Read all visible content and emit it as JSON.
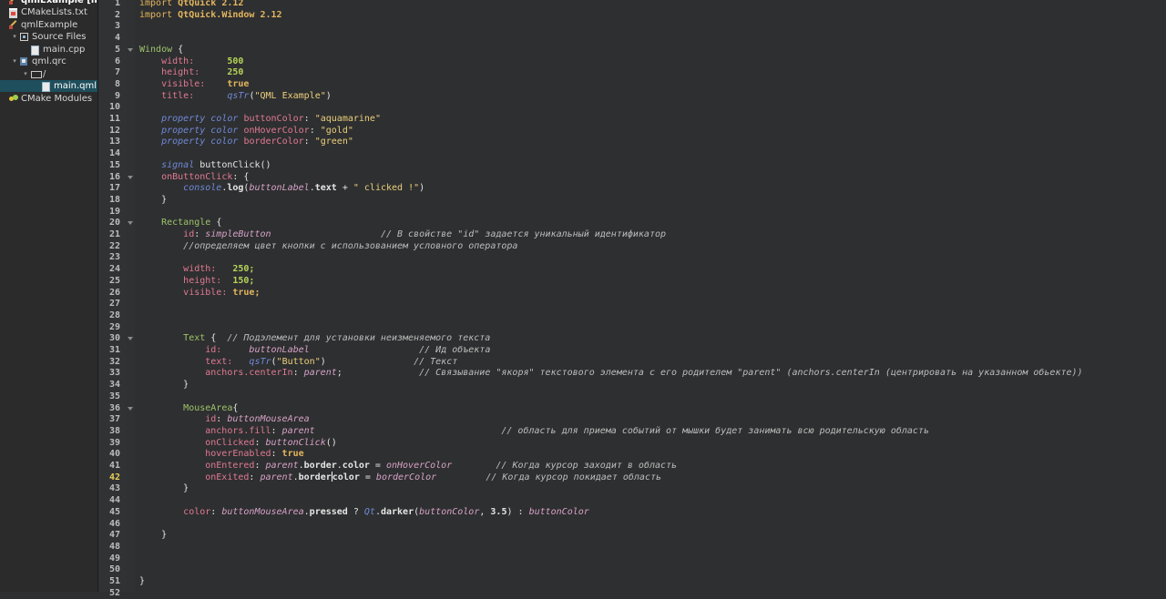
{
  "tree": [
    {
      "label": "qmlExample [mast",
      "icon": "project-icon",
      "indent": 0,
      "arrow": "",
      "title": true
    },
    {
      "label": "CMakeLists.txt",
      "icon": "cmake-icon",
      "indent": 0,
      "arrow": ""
    },
    {
      "label": "qmlExample",
      "icon": "project-icon",
      "indent": 0,
      "arrow": ""
    },
    {
      "label": "Source Files",
      "icon": "source-files-icon",
      "indent": 1,
      "arrow": "▾"
    },
    {
      "label": "main.cpp",
      "icon": "cpp-file-icon",
      "indent": 2,
      "arrow": ""
    },
    {
      "label": "qml.qrc",
      "icon": "qrc-icon",
      "indent": 1,
      "arrow": "▾"
    },
    {
      "label": "/",
      "icon": "folder-icon",
      "indent": 2,
      "arrow": "▾"
    },
    {
      "label": "main.qml",
      "icon": "qml-file-icon",
      "indent": 3,
      "arrow": "",
      "selected": true
    },
    {
      "label": "CMake Modules",
      "icon": "cmake-modules-icon",
      "indent": 0,
      "arrow": ""
    }
  ],
  "editor": {
    "current_line": 42,
    "fold_lines": [
      5,
      16,
      20,
      30,
      36
    ],
    "lines": [
      {
        "n": 1,
        "t": [
          [
            "kw",
            "import "
          ],
          [
            "mod",
            "QtQuick 2.12"
          ]
        ]
      },
      {
        "n": 2,
        "t": [
          [
            "kw",
            "import "
          ],
          [
            "mod",
            "QtQuick.Window 2.12"
          ]
        ]
      },
      {
        "n": 3,
        "t": []
      },
      {
        "n": 4,
        "t": []
      },
      {
        "n": 5,
        "t": [
          [
            "type",
            "Window "
          ],
          [
            "pl",
            "{"
          ]
        ]
      },
      {
        "n": 6,
        "t": [
          [
            "pl",
            "    "
          ],
          [
            "prop",
            "width:"
          ],
          [
            "pl",
            "      "
          ],
          [
            "num",
            "500"
          ]
        ]
      },
      {
        "n": 7,
        "t": [
          [
            "pl",
            "    "
          ],
          [
            "prop",
            "height:"
          ],
          [
            "pl",
            "     "
          ],
          [
            "num",
            "250"
          ]
        ]
      },
      {
        "n": 8,
        "t": [
          [
            "pl",
            "    "
          ],
          [
            "prop",
            "visible:"
          ],
          [
            "pl",
            "    "
          ],
          [
            "kwb",
            "true"
          ]
        ]
      },
      {
        "n": 9,
        "t": [
          [
            "pl",
            "    "
          ],
          [
            "prop",
            "title:"
          ],
          [
            "pl",
            "      "
          ],
          [
            "fn",
            "qsTr"
          ],
          [
            "pl",
            "("
          ],
          [
            "str",
            "\"QML Example\""
          ],
          [
            "pl",
            ")"
          ]
        ]
      },
      {
        "n": 10,
        "t": []
      },
      {
        "n": 11,
        "t": [
          [
            "pl",
            "    "
          ],
          [
            "fn",
            "property"
          ],
          [
            "pl",
            " "
          ],
          [
            "fn",
            "color"
          ],
          [
            "pl",
            " "
          ],
          [
            "prop",
            "buttonColor"
          ],
          [
            "pl",
            ": "
          ],
          [
            "str",
            "\"aquamarine\""
          ]
        ]
      },
      {
        "n": 12,
        "t": [
          [
            "pl",
            "    "
          ],
          [
            "fn",
            "property"
          ],
          [
            "pl",
            " "
          ],
          [
            "fn",
            "color"
          ],
          [
            "pl",
            " "
          ],
          [
            "prop",
            "onHoverColor"
          ],
          [
            "pl",
            ": "
          ],
          [
            "str",
            "\"gold\""
          ]
        ]
      },
      {
        "n": 13,
        "t": [
          [
            "pl",
            "    "
          ],
          [
            "fn",
            "property"
          ],
          [
            "pl",
            " "
          ],
          [
            "fn",
            "color"
          ],
          [
            "pl",
            " "
          ],
          [
            "prop",
            "borderColor"
          ],
          [
            "pl",
            ": "
          ],
          [
            "str",
            "\"green\""
          ]
        ]
      },
      {
        "n": 14,
        "t": []
      },
      {
        "n": 15,
        "t": [
          [
            "pl",
            "    "
          ],
          [
            "fn",
            "signal"
          ],
          [
            "pl",
            " buttonClick()"
          ]
        ]
      },
      {
        "n": 16,
        "t": [
          [
            "pl",
            "    "
          ],
          [
            "prop",
            "onButtonClick"
          ],
          [
            "pl",
            ": {"
          ]
        ]
      },
      {
        "n": 17,
        "t": [
          [
            "pl",
            "        "
          ],
          [
            "fn",
            "console"
          ],
          [
            "pl",
            "."
          ],
          [
            "bold",
            "log"
          ],
          [
            "pl",
            "("
          ],
          [
            "it",
            "buttonLabel"
          ],
          [
            "pl",
            "."
          ],
          [
            "bold",
            "text"
          ],
          [
            "pl",
            " + "
          ],
          [
            "str",
            "\" clicked !\""
          ],
          [
            "pl",
            ")"
          ]
        ]
      },
      {
        "n": 18,
        "t": [
          [
            "pl",
            "    }"
          ]
        ]
      },
      {
        "n": 19,
        "t": []
      },
      {
        "n": 20,
        "t": [
          [
            "pl",
            "    "
          ],
          [
            "type",
            "Rectangle "
          ],
          [
            "pl",
            "{"
          ]
        ]
      },
      {
        "n": 21,
        "t": [
          [
            "pl",
            "        "
          ],
          [
            "prop",
            "id"
          ],
          [
            "pl",
            ": "
          ],
          [
            "it",
            "simpleButton"
          ],
          [
            "pl",
            "                    "
          ],
          [
            "com",
            "// В свойстве \"id\" задается уникальный идентификатор"
          ]
        ]
      },
      {
        "n": 22,
        "t": [
          [
            "pl",
            "        "
          ],
          [
            "com",
            "//определяем цвет кнопки с использованием условного оператора"
          ]
        ]
      },
      {
        "n": 23,
        "t": []
      },
      {
        "n": 24,
        "t": [
          [
            "pl",
            "        "
          ],
          [
            "prop",
            "width:"
          ],
          [
            "pl",
            "   "
          ],
          [
            "num",
            "250;"
          ]
        ]
      },
      {
        "n": 25,
        "t": [
          [
            "pl",
            "        "
          ],
          [
            "prop",
            "height:"
          ],
          [
            "pl",
            "  "
          ],
          [
            "num",
            "150;"
          ]
        ]
      },
      {
        "n": 26,
        "t": [
          [
            "pl",
            "        "
          ],
          [
            "prop",
            "visible:"
          ],
          [
            "pl",
            " "
          ],
          [
            "kwb",
            "true;"
          ]
        ]
      },
      {
        "n": 27,
        "t": []
      },
      {
        "n": 28,
        "t": []
      },
      {
        "n": 29,
        "t": []
      },
      {
        "n": 30,
        "t": [
          [
            "pl",
            "        "
          ],
          [
            "type",
            "Text "
          ],
          [
            "pl",
            "{  "
          ],
          [
            "com",
            "// Подэлемент для установки неизменяемого текста"
          ]
        ]
      },
      {
        "n": 31,
        "t": [
          [
            "pl",
            "            "
          ],
          [
            "prop",
            "id:"
          ],
          [
            "pl",
            "     "
          ],
          [
            "it",
            "buttonLabel"
          ],
          [
            "pl",
            "                    "
          ],
          [
            "com",
            "// Ид объекта"
          ]
        ]
      },
      {
        "n": 32,
        "t": [
          [
            "pl",
            "            "
          ],
          [
            "prop",
            "text:"
          ],
          [
            "pl",
            "   "
          ],
          [
            "fn",
            "qsTr"
          ],
          [
            "pl",
            "("
          ],
          [
            "str",
            "\"Button\""
          ],
          [
            "pl",
            ")"
          ],
          [
            "pl",
            "                "
          ],
          [
            "com",
            "// Текст"
          ]
        ]
      },
      {
        "n": 33,
        "t": [
          [
            "pl",
            "            "
          ],
          [
            "prop",
            "anchors.centerIn"
          ],
          [
            "pl",
            ": "
          ],
          [
            "it",
            "parent"
          ],
          [
            "pl",
            ";"
          ],
          [
            "pl",
            "              "
          ],
          [
            "com",
            "// Связывание \"якоря\" текстового элемента с его родителем \"parent\" (anchors.centerIn (центрировать на указанном обьекте))"
          ]
        ]
      },
      {
        "n": 34,
        "t": [
          [
            "pl",
            "        }"
          ]
        ]
      },
      {
        "n": 35,
        "t": []
      },
      {
        "n": 36,
        "t": [
          [
            "pl",
            "        "
          ],
          [
            "type",
            "MouseArea"
          ],
          [
            "pl",
            "{"
          ]
        ]
      },
      {
        "n": 37,
        "t": [
          [
            "pl",
            "            "
          ],
          [
            "prop",
            "id"
          ],
          [
            "pl",
            ": "
          ],
          [
            "it",
            "buttonMouseArea"
          ]
        ]
      },
      {
        "n": 38,
        "t": [
          [
            "pl",
            "            "
          ],
          [
            "prop",
            "anchors.fill"
          ],
          [
            "pl",
            ": "
          ],
          [
            "it",
            "parent"
          ],
          [
            "pl",
            "                                  "
          ],
          [
            "com",
            "// область для приема событий от мышки будет занимать всю родительскую область"
          ]
        ]
      },
      {
        "n": 39,
        "t": [
          [
            "pl",
            "            "
          ],
          [
            "prop",
            "onClicked"
          ],
          [
            "pl",
            ": "
          ],
          [
            "it",
            "buttonClick"
          ],
          [
            "pl",
            "()"
          ]
        ]
      },
      {
        "n": 40,
        "t": [
          [
            "pl",
            "            "
          ],
          [
            "prop",
            "hoverEnabled"
          ],
          [
            "pl",
            ": "
          ],
          [
            "kwb",
            "true"
          ]
        ]
      },
      {
        "n": 41,
        "t": [
          [
            "pl",
            "            "
          ],
          [
            "prop",
            "onEntered"
          ],
          [
            "pl",
            ": "
          ],
          [
            "it",
            "parent"
          ],
          [
            "pl",
            "."
          ],
          [
            "bold",
            "border"
          ],
          [
            "pl",
            "."
          ],
          [
            "bold",
            "color"
          ],
          [
            "pl",
            " = "
          ],
          [
            "it",
            "onHoverColor"
          ],
          [
            "pl",
            "        "
          ],
          [
            "com",
            "// Когда курсор заходит в область"
          ]
        ]
      },
      {
        "n": 42,
        "t": [
          [
            "pl",
            "            "
          ],
          [
            "prop",
            "onExited"
          ],
          [
            "pl",
            ": "
          ],
          [
            "it",
            "parent"
          ],
          [
            "pl",
            "."
          ],
          [
            "bold",
            "border"
          ],
          [
            "cursor",
            ""
          ],
          [
            "bold",
            "color"
          ],
          [
            "pl",
            " = "
          ],
          [
            "it",
            "borderColor"
          ],
          [
            "pl",
            "         "
          ],
          [
            "com",
            "// Когда курсор покидает область"
          ]
        ]
      },
      {
        "n": 43,
        "t": [
          [
            "pl",
            "        }"
          ]
        ]
      },
      {
        "n": 44,
        "t": []
      },
      {
        "n": 45,
        "t": [
          [
            "pl",
            "        "
          ],
          [
            "prop",
            "color"
          ],
          [
            "pl",
            ": "
          ],
          [
            "it",
            "buttonMouseArea"
          ],
          [
            "pl",
            "."
          ],
          [
            "bold",
            "pressed"
          ],
          [
            "pl",
            " ? "
          ],
          [
            "fn",
            "Qt"
          ],
          [
            "pl",
            "."
          ],
          [
            "bold",
            "darker"
          ],
          [
            "pl",
            "("
          ],
          [
            "it",
            "buttonColor"
          ],
          [
            "pl",
            ", "
          ],
          [
            "bold",
            "3.5"
          ],
          [
            "pl",
            ") : "
          ],
          [
            "it",
            "buttonColor"
          ]
        ]
      },
      {
        "n": 46,
        "t": []
      },
      {
        "n": 47,
        "t": [
          [
            "pl",
            "    }"
          ]
        ]
      },
      {
        "n": 48,
        "t": []
      },
      {
        "n": 49,
        "t": []
      },
      {
        "n": 50,
        "t": []
      },
      {
        "n": 51,
        "t": [
          [
            "pl",
            "}"
          ]
        ]
      },
      {
        "n": 52,
        "t": []
      }
    ]
  }
}
